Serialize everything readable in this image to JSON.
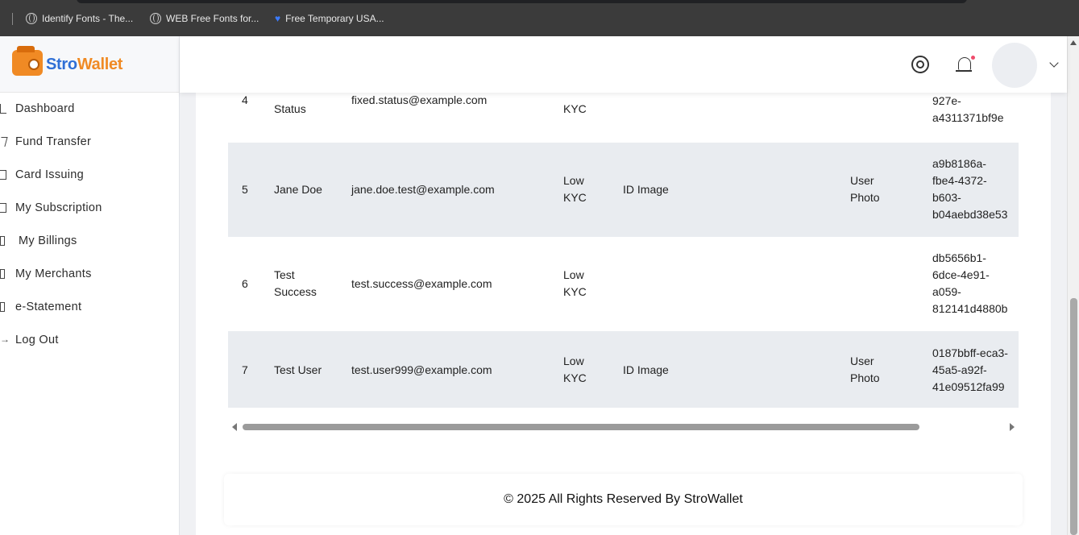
{
  "bookmarks": [
    {
      "label": "Identify Fonts - The...",
      "icon": "globe-icon"
    },
    {
      "label": "WEB Free Fonts for...",
      "icon": "globe-icon"
    },
    {
      "label": "Free Temporary USA...",
      "icon": "heart-icon"
    }
  ],
  "brand": {
    "name_part1": "Stro",
    "name_part2": "Wallet",
    "primary_color": "#2f6fd6",
    "accent_color": "#f08a24"
  },
  "sidebar": {
    "items": [
      {
        "label": "Dashboard",
        "icon": "home-icon"
      },
      {
        "label": "Fund Transfer",
        "icon": "send-icon"
      },
      {
        "label": "Card Issuing",
        "icon": "layers-icon"
      },
      {
        "label": "My Subscription",
        "icon": "layers-icon"
      },
      {
        "label": "My Billings",
        "icon": "receipt-icon"
      },
      {
        "label": "My Merchants",
        "icon": "file-icon"
      },
      {
        "label": "e-Statement",
        "icon": "file-icon"
      },
      {
        "label": "Log Out",
        "icon": "logout-icon"
      }
    ]
  },
  "header": {
    "icons": [
      "gear-icon",
      "bell-icon",
      "avatar",
      "chevron-down-icon"
    ]
  },
  "table": {
    "rows": [
      {
        "no": "4",
        "name": "Status",
        "email": "fixed.status@example.com",
        "kyc": "KYC",
        "id_image": "",
        "user_photo": "",
        "ref": "927e-\na4311371bf9e"
      },
      {
        "no": "5",
        "name": "Jane Doe",
        "email": "jane.doe.test@example.com",
        "kyc": "Low\nKYC",
        "id_image": "ID Image",
        "user_photo": "User\nPhoto",
        "ref": "a9b8186a-\nfbe4-4372-\nb603-\nb04aebd38e53"
      },
      {
        "no": "6",
        "name": "Test\nSuccess",
        "email": "test.success@example.com",
        "kyc": "Low\nKYC",
        "id_image": "",
        "user_photo": "",
        "ref": "db5656b1-\n6dce-4e91-\na059-\n812141d4880b"
      },
      {
        "no": "7",
        "name": "Test User",
        "email": "test.user999@example.com",
        "kyc": "Low\nKYC",
        "id_image": "ID Image",
        "user_photo": "User\nPhoto",
        "ref": "0187bbff-eca3-\n45a5-a92f-\n41e09512fa99"
      }
    ]
  },
  "footer": {
    "text": "© 2025 All Rights Reserved By StroWallet"
  }
}
